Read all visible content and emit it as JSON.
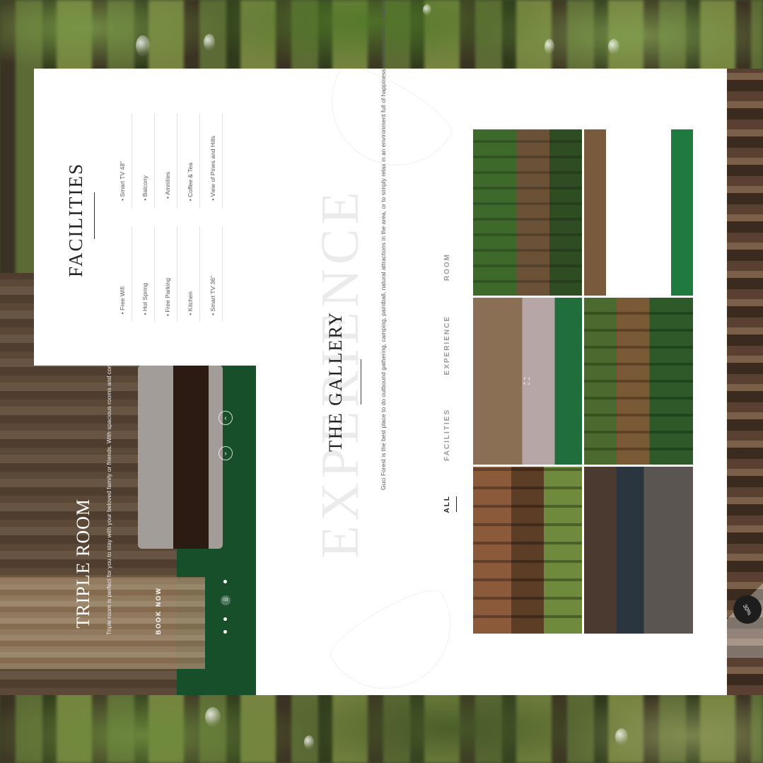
{
  "facilities": {
    "title": "FACILITIES",
    "items": [
      "Free Wifi",
      "Hot Spring",
      "Free Parking",
      "Kitchen",
      "Smart TV 36\"",
      "Smart TV 48\"",
      "Balcony",
      "Amnities",
      "Coffee & Tea",
      "View of Pines and Hills"
    ]
  },
  "room": {
    "title": "TRIPLE ROOM",
    "description": "Triple room is perfect for you to stay with your beloved family or friends. With spacious rooms and complete facilities, you will have a comfortable stay at Guci Forest.",
    "book_label": "BOOK NOW",
    "slide_index": "03",
    "prev_icon": "chevron-up",
    "next_icon": "chevron-down"
  },
  "gallery": {
    "watermark": "EXPERIENCE",
    "title": "THE GALLERY",
    "description": "Guci Forest is the best place to do outbound gathering, camping, paintball, natural attractions in the area, or to simply relax in an environment full of happiness and deep serenity with loved ones.",
    "filters": [
      "ALL",
      "FACILITIES",
      "EXPERIENCE",
      "ROOM"
    ],
    "active_filter": "ALL"
  },
  "promo": {
    "badge": "30%"
  }
}
